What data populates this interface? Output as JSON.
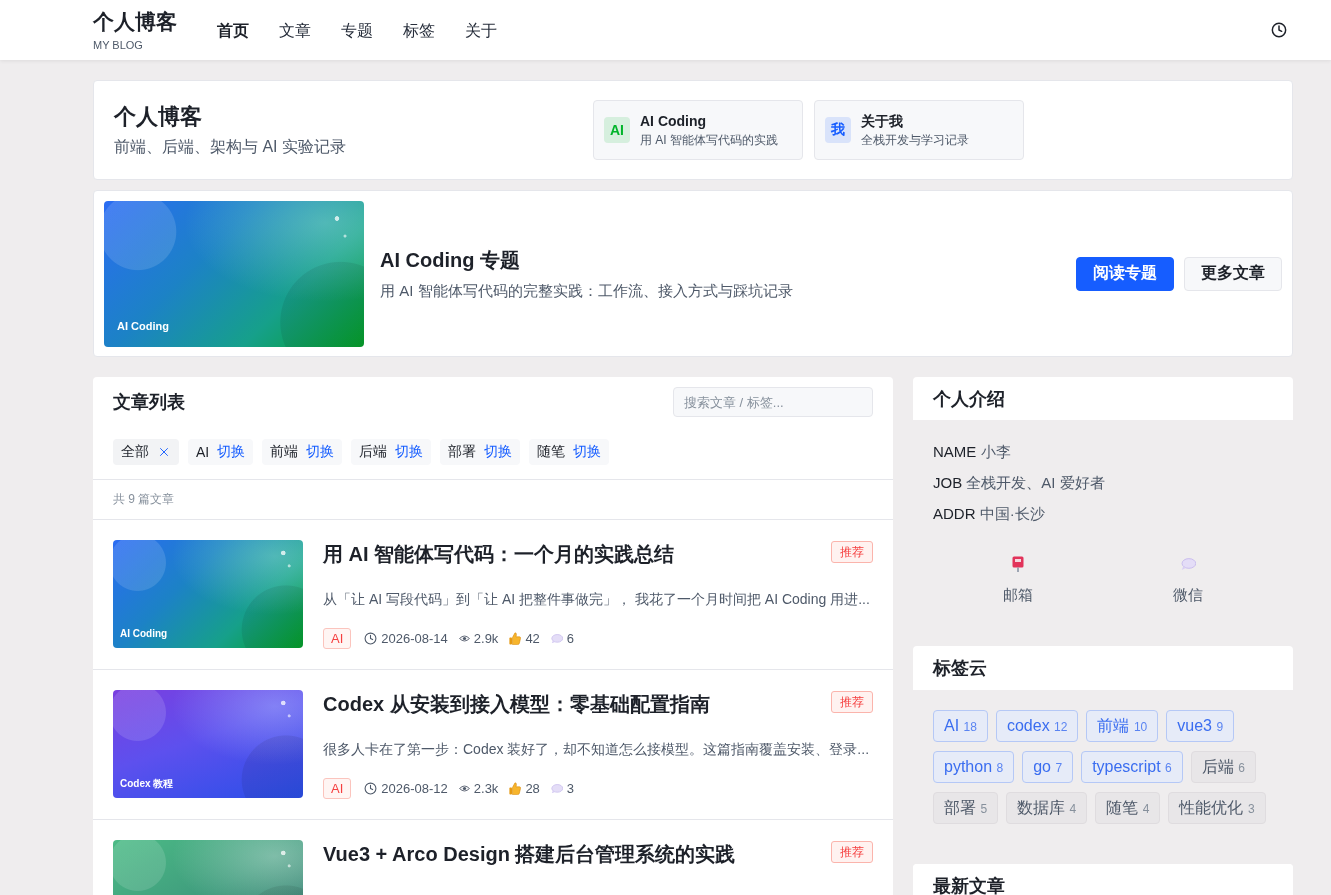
{
  "header": {
    "logo": {
      "title": "个人博客",
      "subtitle": "MY BLOG"
    },
    "nav": [
      {
        "label": "首页",
        "selected": true
      },
      {
        "label": "文章",
        "selected": false
      },
      {
        "label": "专题",
        "selected": false
      },
      {
        "label": "标签",
        "selected": false
      },
      {
        "label": "关于",
        "selected": false
      }
    ]
  },
  "intro": {
    "title": "个人博客",
    "subtitle": "前端、后端、架构与 AI 实验记录",
    "links": [
      {
        "badge": "AI",
        "title": "AI Coding",
        "desc": "用 AI 智能体写代码的实践",
        "color": "#00b42a"
      },
      {
        "badge": "我",
        "title": "关于我",
        "desc": "全栈开发与学习记录",
        "color": "#165dff"
      }
    ]
  },
  "featured": {
    "cover": {
      "label": "AI Coding",
      "kind": "ocean"
    },
    "title": "AI Coding 专题",
    "desc": "用 AI 智能体写代码的完整实践：工作流、接入方式与踩坑记录",
    "buttons": [
      {
        "label": "阅读专题",
        "kind": "primary"
      },
      {
        "label": "更多文章",
        "kind": "default"
      }
    ]
  },
  "articles": {
    "title": "文章列表",
    "search": {
      "placeholder": "搜索文章 / 标签..."
    },
    "filters": [
      {
        "label": "全部",
        "selected": true
      },
      {
        "label": "AI",
        "action": "切换",
        "selected": false
      },
      {
        "label": "前端",
        "action": "切换",
        "selected": false
      },
      {
        "label": "后端",
        "action": "切换",
        "selected": false
      },
      {
        "label": "部署",
        "action": "切换",
        "selected": false
      },
      {
        "label": "随笔",
        "action": "切换",
        "selected": false
      }
    ],
    "count": "共 9 篇文章",
    "items": [
      {
        "cover": {
          "label": "AI Coding",
          "kind": "ocean"
        },
        "title": "用 AI 智能体写代码：一个月的实践总结",
        "badge": "推荐",
        "excerpt": "从「让 AI 写段代码」到「让 AI 把整件事做完」， 我花了一个月时间把 AI Coding 用进...",
        "tag": "AI",
        "date": "2026-08-14",
        "views": "2.9k",
        "likes": "42",
        "comments": "6"
      },
      {
        "cover": {
          "label": "Codex 教程",
          "kind": "violet"
        },
        "title": "Codex 从安装到接入模型：零基础配置指南",
        "badge": "推荐",
        "excerpt": "很多人卡在了第一步：Codex 装好了，却不知道怎么接模型。这篇指南覆盖安装、登录...",
        "tag": "AI",
        "date": "2026-08-12",
        "views": "2.3k",
        "likes": "28",
        "comments": "3"
      },
      {
        "cover": {
          "kind": "forest"
        },
        "title": "Vue3 + Arco Design 搭建后台管理系统的实践",
        "badge": "推荐"
      }
    ]
  },
  "sidebar": {
    "profile": {
      "title": "个人介绍",
      "fields": [
        {
          "key": "NAME",
          "value": "小李"
        },
        {
          "key": "JOB",
          "value": "全栈开发、AI 爱好者"
        },
        {
          "key": "ADDR",
          "value": "中国·长沙"
        }
      ],
      "contacts": [
        {
          "label": "邮箱",
          "kind": "mail"
        },
        {
          "label": "微信",
          "kind": "chat"
        }
      ]
    },
    "tag_cloud": {
      "title": "标签云",
      "tags": [
        {
          "name": "AI",
          "count": "18",
          "highlighted": true
        },
        {
          "name": "codex",
          "count": "12",
          "highlighted": true
        },
        {
          "name": "前端",
          "count": "10",
          "highlighted": true
        },
        {
          "name": "vue3",
          "count": "9",
          "highlighted": true
        },
        {
          "name": "python",
          "count": "8",
          "highlighted": true
        },
        {
          "name": "go",
          "count": "7",
          "highlighted": true
        },
        {
          "name": "typescript",
          "count": "6",
          "highlighted": true
        },
        {
          "name": "后端",
          "count": "6",
          "highlighted": false
        },
        {
          "name": "部署",
          "count": "5",
          "highlighted": false
        },
        {
          "name": "数据库",
          "count": "4",
          "highlighted": false
        },
        {
          "name": "随笔",
          "count": "4",
          "highlighted": false
        },
        {
          "name": "性能优化",
          "count": "3",
          "highlighted": false
        }
      ]
    },
    "latest": {
      "title": "最新文章"
    }
  }
}
